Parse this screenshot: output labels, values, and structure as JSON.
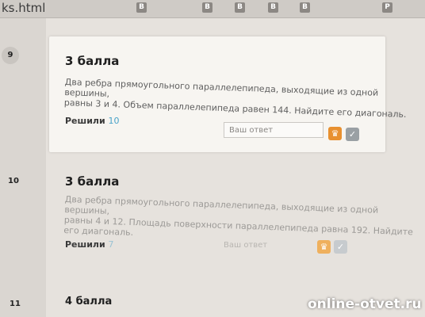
{
  "browser": {
    "url_fragment": "ks.html",
    "tab_icons": [
      "B",
      "B",
      "B",
      "B",
      "B",
      "P"
    ]
  },
  "questions": [
    {
      "number": "9",
      "points": "3 балла",
      "text_lines": [
        "Два ребра прямоугольного параллелепипеда, выходящие из одной вершины,",
        "равны 3 и 4. Объем параллелепипеда равен 144. Найдите его диагональ."
      ],
      "solved_label": "Решили",
      "solved_count": "10",
      "answer_placeholder": "Ваш ответ"
    },
    {
      "number": "10",
      "points": "3 балла",
      "text_lines": [
        "Два ребра прямоугольного параллелепипеда, выходящие из одной вершины,",
        "равны 4 и 12. Площадь поверхности параллелепипеда равна 192. Найдите",
        "его диагональ."
      ],
      "solved_label": "Решили",
      "solved_count": "7",
      "answer_placeholder": "Ваш ответ"
    },
    {
      "number": "11",
      "points": "4 балла"
    }
  ],
  "icons": {
    "submit": "cup-icon",
    "check": "check-icon"
  },
  "watermark": "online-otvet.ru"
}
